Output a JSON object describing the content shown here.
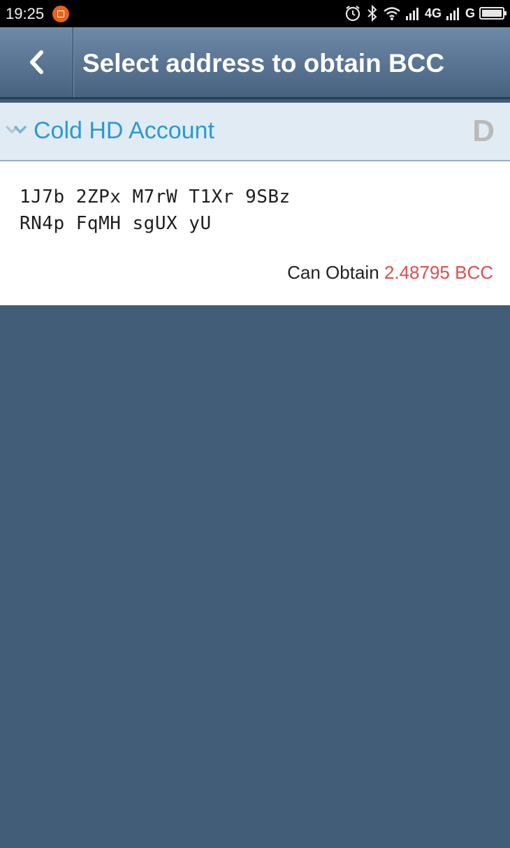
{
  "status_bar": {
    "time": "19:25",
    "network_1": "4G",
    "network_2": "G",
    "icons": [
      "notification-icon",
      "alarm-icon",
      "bluetooth-icon",
      "wifi-icon",
      "signal-icon",
      "signal-icon",
      "battery-icon"
    ]
  },
  "header": {
    "title": "Select address to obtain BCC",
    "back_icon": "chevron-left-icon"
  },
  "account": {
    "name": "Cold HD Account",
    "badge": "D",
    "expand_icon": "chevron-down-icon"
  },
  "address_item": {
    "address_line_1": "1J7b 2ZPx M7rW T1Xr 9SBz",
    "address_line_2": "RN4p FqMH sgUX yU",
    "obtain_label": "Can Obtain",
    "obtain_amount": "2.48795 BCC"
  },
  "colors": {
    "app_bar": "#5d7897",
    "background": "#425d78",
    "account_name": "#2a9bd0",
    "amount": "#e24b4b"
  }
}
